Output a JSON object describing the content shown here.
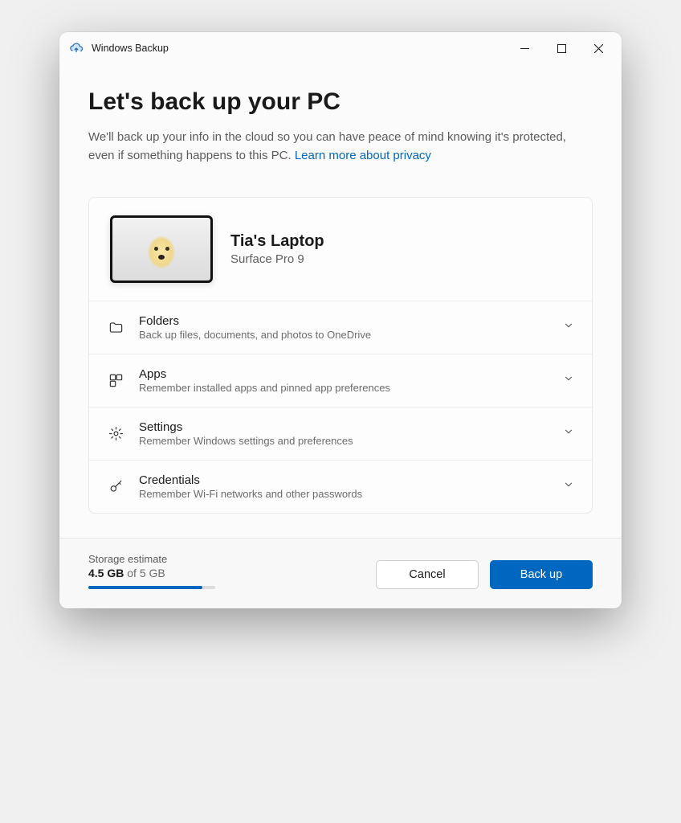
{
  "titlebar": {
    "app_name": "Windows Backup"
  },
  "main": {
    "heading": "Let's back up your PC",
    "subtitle_a": "We'll back up your info in the cloud so you can have peace of mind knowing it's protected, even if something happens to this PC.  ",
    "privacy_link": "Learn more about privacy"
  },
  "device": {
    "name": "Tia's Laptop",
    "model": "Surface Pro 9"
  },
  "options": [
    {
      "key": "folders",
      "title": "Folders",
      "desc": "Back up files, documents, and photos to OneDrive"
    },
    {
      "key": "apps",
      "title": "Apps",
      "desc": "Remember installed apps and pinned app preferences"
    },
    {
      "key": "settings",
      "title": "Settings",
      "desc": "Remember Windows settings and preferences"
    },
    {
      "key": "credentials",
      "title": "Credentials",
      "desc": "Remember Wi-Fi networks and other passwords"
    }
  ],
  "footer": {
    "storage_label": "Storage estimate",
    "storage_used": "4.5 GB",
    "storage_of": " of 5 GB",
    "progress_pct": 90,
    "cancel": "Cancel",
    "backup": "Back up"
  },
  "colors": {
    "accent": "#0067c0"
  }
}
